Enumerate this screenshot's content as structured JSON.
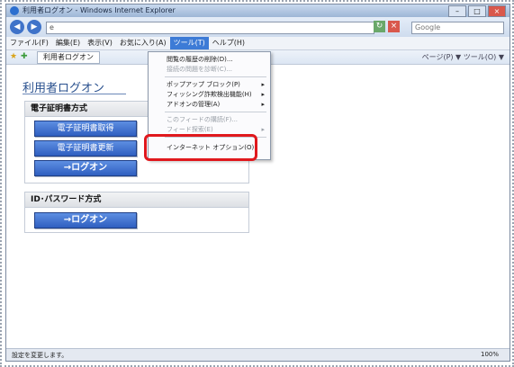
{
  "window": {
    "title": "利用者ログオン - Windows Internet Explorer"
  },
  "address_bar": {
    "url": "e",
    "search_placeholder": "Google"
  },
  "menu_bar": {
    "items": [
      "ファイル(F)",
      "編集(E)",
      "表示(V)",
      "お気に入り(A)",
      "ツール(T)",
      "ヘルプ(H)"
    ],
    "active_item": "ツール(T)"
  },
  "favorites_bar": {
    "tab_label": "利用者ログオン",
    "tools_text": "ページ(P) ▼  ツール(O) ▼"
  },
  "page": {
    "title": "利用者ログオン",
    "cert_section": {
      "header": "電子証明書方式",
      "acquire_button": "電子証明書取得",
      "renew_button": "電子証明書更新",
      "logon_button": "→ログオン"
    },
    "password_section": {
      "header": "ID･パスワード方式",
      "logon_button": "→ログオン"
    }
  },
  "tools_menu": {
    "items": [
      {
        "label": "閲覧の履歴の削除(D)...",
        "disabled": false,
        "submenu": false
      },
      {
        "label": "接続の問題を診断(C)...",
        "disabled": true,
        "submenu": false
      },
      {
        "label": "ポップアップ ブロック(P)",
        "disabled": false,
        "submenu": true
      },
      {
        "label": "フィッシング詐欺検出機能(H)",
        "disabled": false,
        "submenu": true
      },
      {
        "label": "アドオンの管理(A)",
        "disabled": false,
        "submenu": true
      },
      {
        "label": "このフィードの購読(F)...",
        "disabled": true,
        "submenu": false
      },
      {
        "label": "フィード探索(E)",
        "disabled": true,
        "submenu": true
      },
      {
        "label": "インターネット オプション(O)",
        "disabled": false,
        "submenu": false
      }
    ]
  },
  "status_bar": {
    "text": "設定を変更します。",
    "zoom": "100%"
  },
  "colors": {
    "highlight": "#e0181d",
    "button_blue": "#2f5fc0",
    "title_text": "#29508e"
  }
}
